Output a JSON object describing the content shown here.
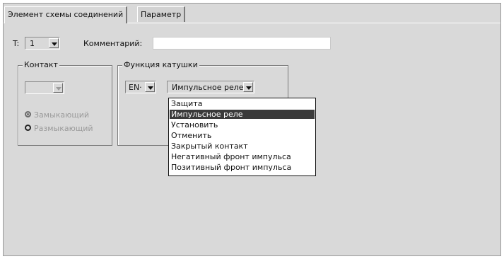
{
  "tabs": [
    {
      "label": "Элемент схемы соединений",
      "active": true
    },
    {
      "label": "Параметр",
      "active": false
    }
  ],
  "t_field": {
    "label": "T:",
    "value": "1"
  },
  "comment": {
    "label": "Комментарий:",
    "value": ""
  },
  "contact_group": {
    "title": "Контакт",
    "dropdown_value": "",
    "radios": [
      {
        "label": "Замыкающий",
        "checked": true
      },
      {
        "label": "Размыкающий",
        "checked": false
      }
    ]
  },
  "coil_group": {
    "title": "Функция катушки",
    "en_value": "EN·",
    "function_value": "Импульсное реле"
  },
  "function_options": [
    "Защита",
    "Импульсное реле",
    "Установить",
    "Отменить",
    "Закрытый контакт",
    "Негативный фронт импульса",
    "Позитивный фронт импульса"
  ],
  "selected_option": "Импульсное реле",
  "colors": {
    "window_bg": "#d9d9d9",
    "selection_bg": "#3a3a3a",
    "selection_text": "#ffffff"
  }
}
